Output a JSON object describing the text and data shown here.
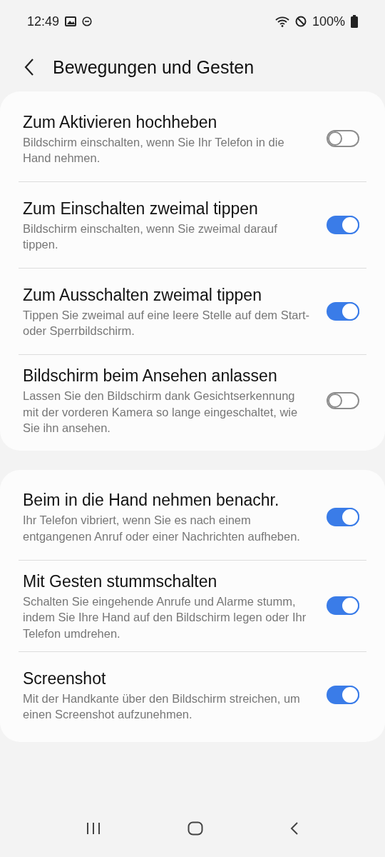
{
  "status_bar": {
    "time": "12:49",
    "battery": "100%"
  },
  "header": {
    "title": "Bewegungen und Gesten"
  },
  "groups": [
    {
      "items": [
        {
          "title": "Zum Aktivieren hochheben",
          "description": "Bildschirm einschalten, wenn Sie Ihr Telefon in die Hand nehmen.",
          "on": false
        },
        {
          "title": "Zum Einschalten zweimal tippen",
          "description": "Bildschirm einschalten, wenn Sie zweimal darauf tippen.",
          "on": true
        },
        {
          "title": "Zum Ausschalten zweimal tippen",
          "description": "Tippen Sie zweimal auf eine leere Stelle auf dem Start- oder Sperrbildschirm.",
          "on": true
        },
        {
          "title": "Bildschirm beim Ansehen anlassen",
          "description": "Lassen Sie den Bildschirm dank Gesichtserkennung mit der vorderen Kamera so lange eingeschaltet, wie Sie ihn ansehen.",
          "on": false
        }
      ]
    },
    {
      "items": [
        {
          "title": "Beim in die Hand nehmen benachr.",
          "description": "Ihr Telefon vibriert, wenn Sie es nach einem entgangenen Anruf oder einer Nachrichten aufheben.",
          "on": true
        },
        {
          "title": "Mit Gesten stummschalten",
          "description": "Schalten Sie eingehende Anrufe und Alarme stumm, indem Sie Ihre Hand auf den Bildschirm legen oder Ihr Telefon umdrehen.",
          "on": true
        },
        {
          "title": "Screenshot",
          "description": "Mit der Handkante über den Bildschirm streichen, um einen Screenshot aufzunehmen.",
          "on": true
        }
      ]
    }
  ]
}
